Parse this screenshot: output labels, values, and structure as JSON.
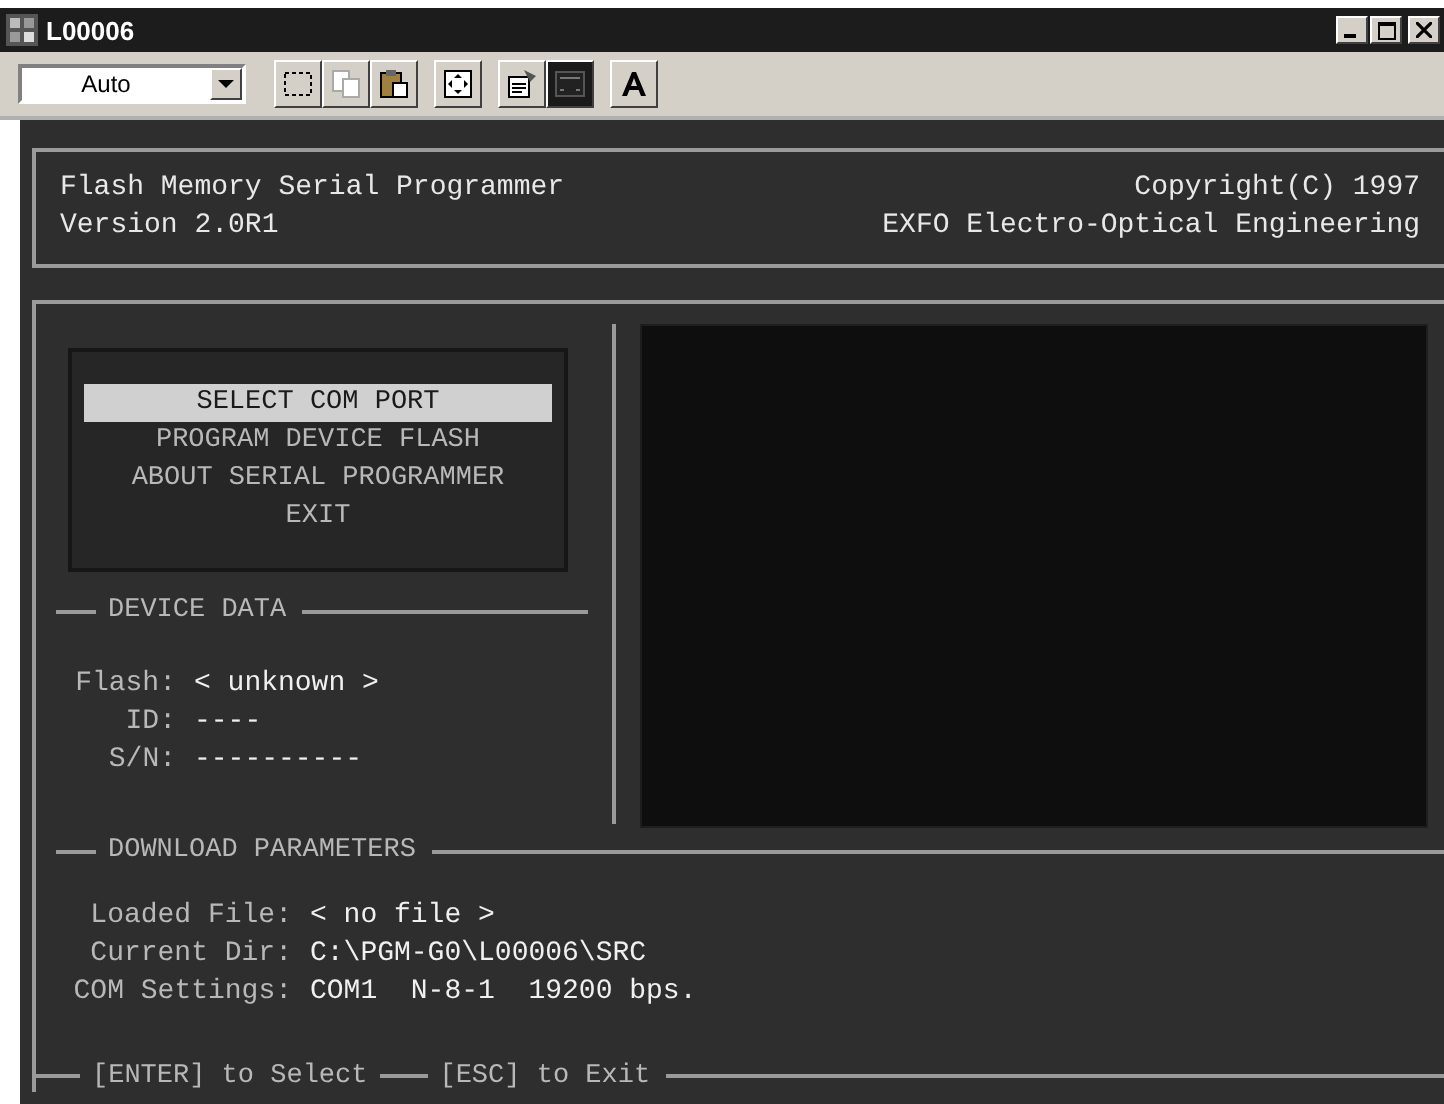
{
  "window": {
    "title": "L00006"
  },
  "toolbar": {
    "font_size_dropdown": {
      "value": "Auto"
    }
  },
  "header": {
    "left": [
      "Flash Memory Serial Programmer",
      "Version 2.0R1"
    ],
    "right": [
      "Copyright(C) 1997",
      "EXFO Electro-Optical Engineering"
    ]
  },
  "menu": [
    {
      "label": "SELECT COM PORT",
      "selected": true
    },
    {
      "label": "PROGRAM DEVICE FLASH",
      "selected": false
    },
    {
      "label": "ABOUT SERIAL PROGRAMMER",
      "selected": false
    },
    {
      "label": "EXIT",
      "selected": false
    }
  ],
  "device_data": {
    "title": "DEVICE DATA",
    "fields": [
      {
        "label": "Flash:",
        "value": "< unknown >"
      },
      {
        "label": "ID:",
        "value": "----"
      },
      {
        "label": "S/N:",
        "value": "----------"
      }
    ]
  },
  "download_parameters": {
    "title": "DOWNLOAD PARAMETERS",
    "fields": [
      {
        "label": "Loaded File:",
        "value": "< no file >"
      },
      {
        "label": "Current Dir:",
        "value": "C:\\PGM-G0\\L00006\\SRC"
      },
      {
        "label": "COM Settings:",
        "value": "COM1  N-8-1  19200 bps."
      }
    ]
  },
  "footer": [
    "[ENTER] to Select",
    "[ESC] to Exit"
  ]
}
